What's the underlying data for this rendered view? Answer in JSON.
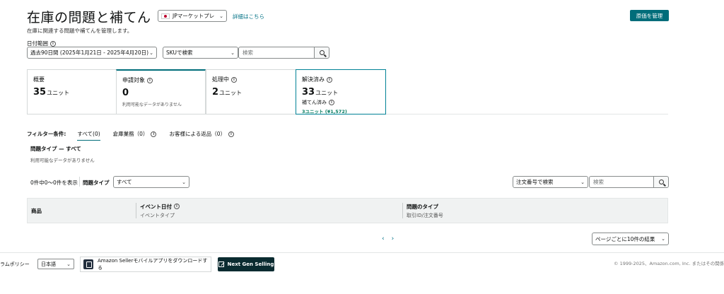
{
  "header": {
    "title": "在庫の問題と補てん",
    "marketplace": "JPマーケットプレ",
    "details_link": "詳細はこちら",
    "manage_button": "原価を管理",
    "subtitle": "在庫に関連する問題や補てんを管理します。"
  },
  "filters": {
    "date_label": "日付範囲",
    "date_value": "過去90日間 (2025年1月21日 - 2025年4月20日)",
    "sku_select": "SKUで検索",
    "search_placeholder": "検索"
  },
  "cards": [
    {
      "label": "概要",
      "value": "35",
      "unit": "ユニット"
    },
    {
      "label": "申請対象",
      "value": "0",
      "unit": "",
      "note": "利用可能なデータがありません"
    },
    {
      "label": "処理中",
      "value": "2",
      "unit": "ユニット"
    },
    {
      "label": "解決済み",
      "value": "33",
      "unit": "ユニット",
      "sub_label": "補てん済み",
      "sub_value": "3ユニット (¥1,572)"
    }
  ],
  "filter_tabs": {
    "label": "フィルター条件:",
    "items": [
      "すべて(0)",
      "倉庫業務（0）",
      "お客様による返品（0）"
    ]
  },
  "issue_section": {
    "title": "問題タイプ — すべて",
    "no_data": "利用可能なデータがありません"
  },
  "table_controls": {
    "count": "0件中0～0件を表示",
    "type_label": "問題タイプ",
    "type_value": "すべて",
    "order_select": "注文番号で検索",
    "search_placeholder": "検索"
  },
  "table": {
    "columns": [
      {
        "title": "商品",
        "sub": ""
      },
      {
        "title": "イベント日付",
        "sub": "イベントタイプ"
      },
      {
        "title": "問題のタイプ",
        "sub": "取引ID/注文番号"
      }
    ]
  },
  "pagination": {
    "prev": "‹",
    "next": "›",
    "per_page": "ページごとに10件の結果"
  },
  "footer": {
    "policy": "ラムポリシー",
    "language": "日本語",
    "app_download": "Amazon Sellerモバイルアプリをダウンロードする",
    "next_gen": "Next Gen Selling",
    "copyright": "© 1999-2025、Amazon.com, Inc. またはその関係"
  }
}
